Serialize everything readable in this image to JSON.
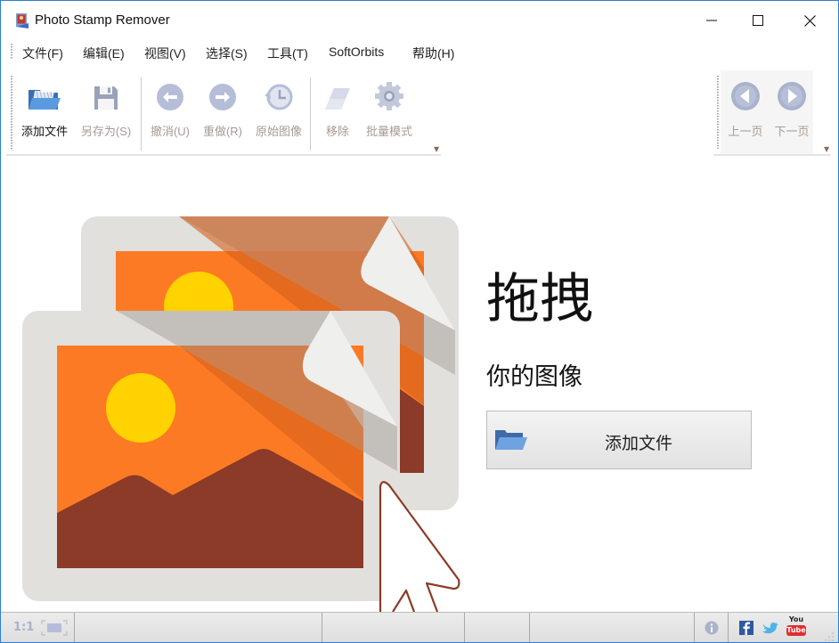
{
  "window": {
    "title": "Photo Stamp Remover",
    "icons": [
      "app-photo-icon",
      "minimize-icon",
      "maximize-icon",
      "close-icon"
    ]
  },
  "menu": {
    "items": [
      {
        "label": "文件(F)"
      },
      {
        "label": "编辑(E)"
      },
      {
        "label": "视图(V)"
      },
      {
        "label": "选择(S)"
      },
      {
        "label": "工具(T)"
      },
      {
        "label": "SoftOrbits"
      },
      {
        "label": "帮助(H)"
      }
    ]
  },
  "toolbar": {
    "buttons": [
      {
        "label": "添加文件",
        "icon": "open-folder-icon",
        "enabled": true
      },
      {
        "label": "另存为(S)",
        "icon": "save-icon",
        "enabled": false
      },
      {
        "label": "撤消(U)",
        "icon": "undo-arrow-icon",
        "enabled": false
      },
      {
        "label": "重做(R)",
        "icon": "redo-arrow-icon",
        "enabled": false
      },
      {
        "label": "原始图像",
        "icon": "history-clock-icon",
        "enabled": false
      },
      {
        "label": "移除",
        "icon": "eraser-icon",
        "enabled": false
      },
      {
        "label": "批量模式",
        "icon": "gear-icon",
        "enabled": false
      }
    ],
    "nav_buttons": [
      {
        "label": "上一页",
        "icon": "previous-page-icon",
        "enabled": false
      },
      {
        "label": "下一页",
        "icon": "next-page-icon",
        "enabled": false
      }
    ]
  },
  "main": {
    "drag_title": "拖拽",
    "drag_subtitle": "你的图像",
    "add_button_label": "添加文件",
    "illustration": "stacked-photos-with-cursor"
  },
  "statusbar": {
    "zoom_label": "1:1",
    "icons": [
      "fit-screen-icon",
      "info-icon",
      "facebook-icon",
      "twitter-icon",
      "youtube-icon"
    ],
    "youtube_top": "You",
    "youtube_bottom": "Tube"
  },
  "colors": {
    "accent_border": "#2b7fcf",
    "photo_orange": "#fd7a24",
    "photo_mountain": "#8b3b27",
    "sun_yellow": "#ffd200",
    "frame_gray": "#e2e0dd",
    "icon_disabled": "#b5bdd8",
    "folder_blue": "#5a8fd6"
  }
}
